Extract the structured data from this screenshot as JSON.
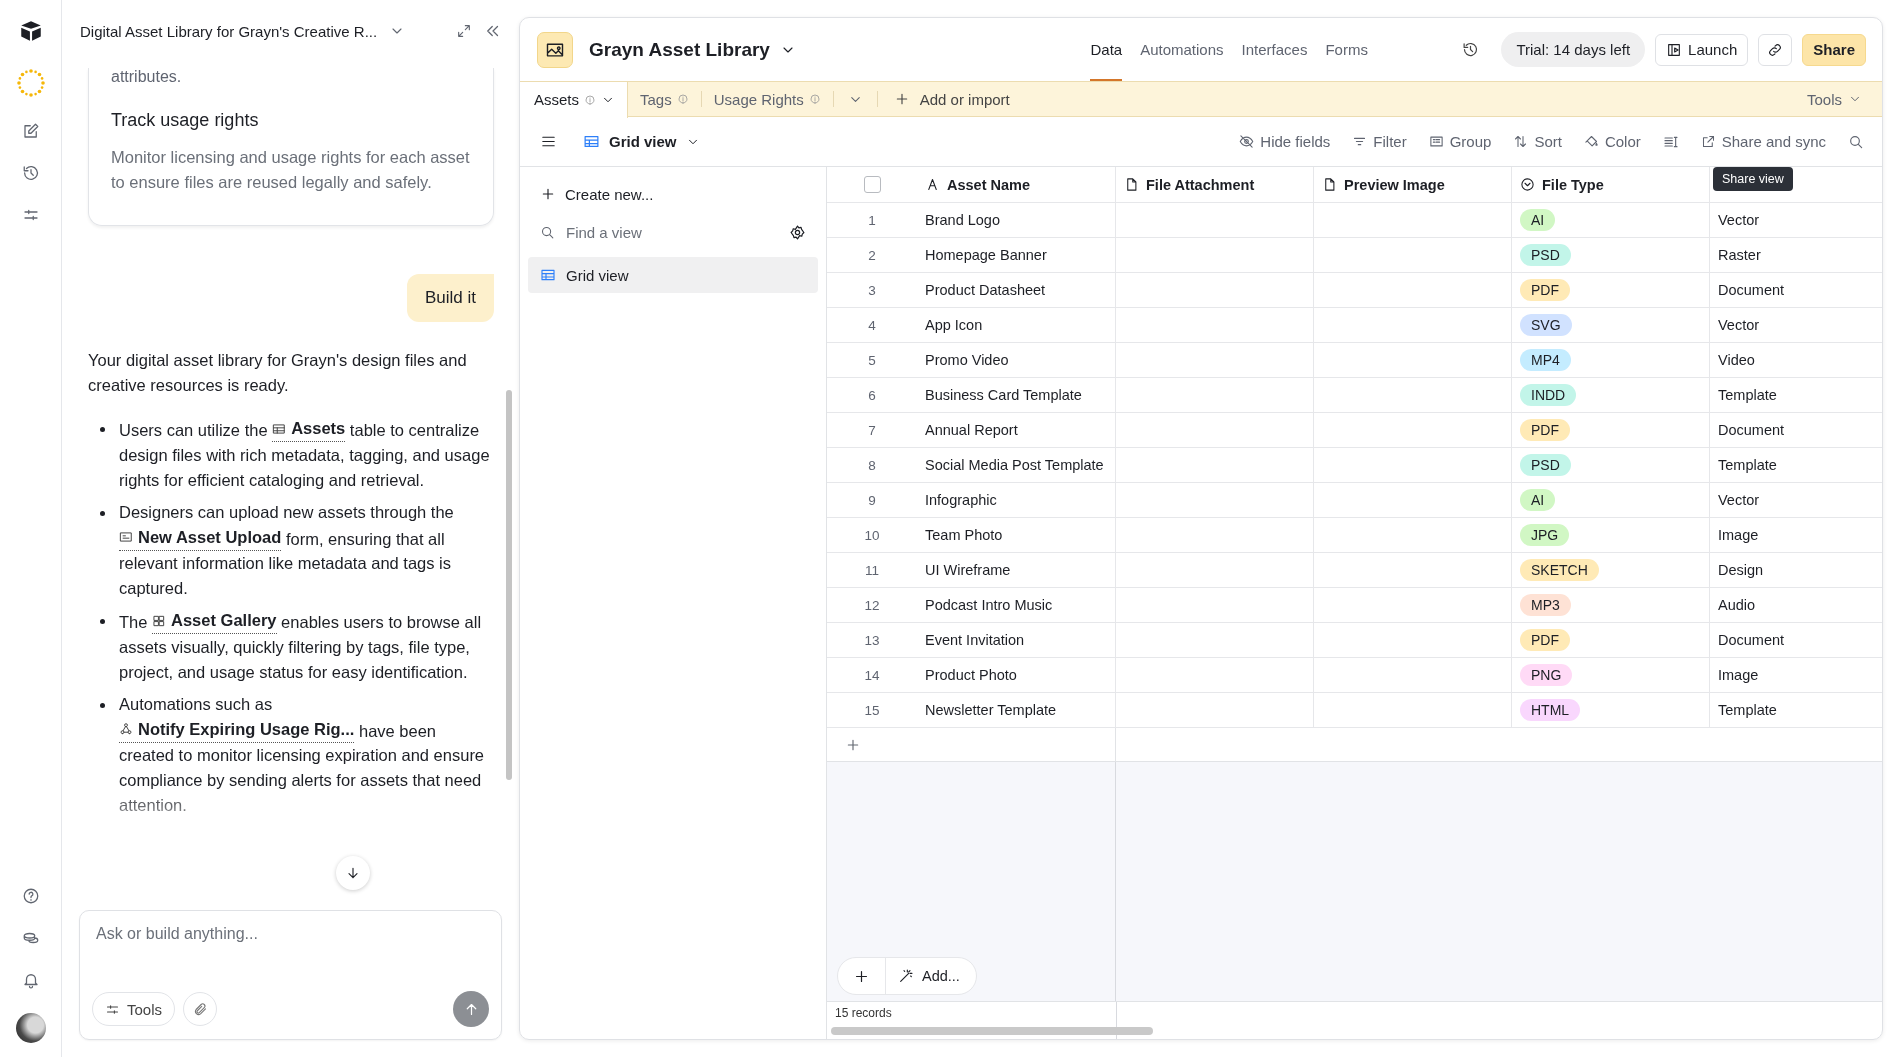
{
  "chat": {
    "title": "Digital Asset Library for Grayn's Creative R...",
    "card": {
      "tail": "attributes.",
      "heading": "Track usage rights",
      "body": "Monitor licensing and usage rights for each asset to ensure files are reused legally and safely."
    },
    "user_message": "Build it",
    "reply": {
      "intro": "Your digital asset library for Grayn's design files and creative resources is ready.",
      "bullets": [
        {
          "before": "Users can utilize the",
          "link": {
            "kind": "table",
            "label": "Assets"
          },
          "after": "table to centralize design files with rich metadata, tagging, and usage rights for efficient cataloging and retrieval."
        },
        {
          "before": "Designers can upload new assets through the",
          "link": {
            "kind": "form",
            "label": "New Asset Upload"
          },
          "after": "form, ensuring that all relevant information like metadata and tags is captured."
        },
        {
          "before": "The",
          "link": {
            "kind": "gallery",
            "label": "Asset Gallery"
          },
          "after": "enables users to browse all assets visually, quickly filtering by tags, file type, project, and usage status for easy identification."
        },
        {
          "before": "Automations such as",
          "link": {
            "kind": "automation",
            "label": "Notify Expiring Usage Rig..."
          },
          "after": "have been created to monitor licensing expiration and ensure compliance by sending alerts for assets that need attention."
        }
      ]
    },
    "input": {
      "placeholder": "Ask or build anything..."
    },
    "tools_button": "Tools"
  },
  "base": {
    "name": "Grayn Asset Library",
    "nav": [
      {
        "label": "Data",
        "selected": true
      },
      {
        "label": "Automations",
        "selected": false
      },
      {
        "label": "Interfaces",
        "selected": false
      },
      {
        "label": "Forms",
        "selected": false
      }
    ],
    "trial": "Trial: 14 days left",
    "launch": "Launch",
    "share": "Share"
  },
  "tables": [
    {
      "label": "Assets",
      "selected": true
    },
    {
      "label": "Tags",
      "selected": false
    },
    {
      "label": "Usage Rights",
      "selected": false
    }
  ],
  "add_table": "Add or import",
  "tools": "Tools",
  "view": {
    "name": "Grid view",
    "actions": [
      {
        "kind": "hide",
        "label": "Hide fields"
      },
      {
        "kind": "filter",
        "label": "Filter"
      },
      {
        "kind": "group",
        "label": "Group"
      },
      {
        "kind": "sort",
        "label": "Sort"
      },
      {
        "kind": "color",
        "label": "Color"
      },
      {
        "kind": "height"
      },
      {
        "kind": "share",
        "label": "Share and sync"
      },
      {
        "kind": "search"
      }
    ]
  },
  "views_panel": {
    "create": "Create new...",
    "search_placeholder": "Find a view",
    "views": [
      {
        "name": "Grid view",
        "selected": true
      }
    ]
  },
  "grid": {
    "columns": [
      {
        "kind": "text",
        "label": "Asset Name"
      },
      {
        "kind": "file",
        "label": "File Attachment"
      },
      {
        "kind": "file",
        "label": "Preview Image"
      },
      {
        "kind": "select",
        "label": "File Type"
      }
    ],
    "select_all_checked": false,
    "tooltip": "Share view",
    "rows": [
      {
        "number": "1",
        "name": "Brand Logo",
        "file_type": {
          "label": "AI",
          "color": "#d1f7c4"
        },
        "column_6": "Vector"
      },
      {
        "number": "2",
        "name": "Homepage Banner",
        "file_type": {
          "label": "PSD",
          "color": "#c2f5e9"
        },
        "column_6": "Raster"
      },
      {
        "number": "3",
        "name": "Product Datasheet",
        "file_type": {
          "label": "PDF",
          "color": "#ffeab6"
        },
        "column_6": "Document"
      },
      {
        "number": "4",
        "name": "App Icon",
        "file_type": {
          "label": "SVG",
          "color": "#d1e2ff"
        },
        "column_6": "Vector"
      },
      {
        "number": "5",
        "name": "Promo Video",
        "file_type": {
          "label": "MP4",
          "color": "#c4ecff"
        },
        "column_6": "Video"
      },
      {
        "number": "6",
        "name": "Business Card Template",
        "file_type": {
          "label": "INDD",
          "color": "#c2f5e9"
        },
        "column_6": "Template"
      },
      {
        "number": "7",
        "name": "Annual Report",
        "file_type": {
          "label": "PDF",
          "color": "#ffeab6"
        },
        "column_6": "Document"
      },
      {
        "number": "8",
        "name": "Social Media Post Template",
        "file_type": {
          "label": "PSD",
          "color": "#c2f5e9"
        },
        "column_6": "Template"
      },
      {
        "number": "9",
        "name": "Infographic",
        "file_type": {
          "label": "AI",
          "color": "#d1f7c4"
        },
        "column_6": "Vector"
      },
      {
        "number": "10",
        "name": "Team Photo",
        "file_type": {
          "label": "JPG",
          "color": "#d1f7c4"
        },
        "column_6": "Image"
      },
      {
        "number": "11",
        "name": "UI Wireframe",
        "file_type": {
          "label": "SKETCH",
          "color": "#ffeab6"
        },
        "column_6": "Design"
      },
      {
        "number": "12",
        "name": "Podcast Intro Music",
        "file_type": {
          "label": "MP3",
          "color": "#fee2d5"
        },
        "column_6": "Audio"
      },
      {
        "number": "13",
        "name": "Event Invitation",
        "file_type": {
          "label": "PDF",
          "color": "#ffeab6"
        },
        "column_6": "Document"
      },
      {
        "number": "14",
        "name": "Product Photo",
        "file_type": {
          "label": "PNG",
          "color": "#ffdaf6"
        },
        "column_6": "Image"
      },
      {
        "number": "15",
        "name": "Newsletter Template",
        "file_type": {
          "label": "HTML",
          "color": "#f9d7fd"
        },
        "column_6": "Template"
      }
    ],
    "add_label": "Add...",
    "record_count": "15 records"
  }
}
